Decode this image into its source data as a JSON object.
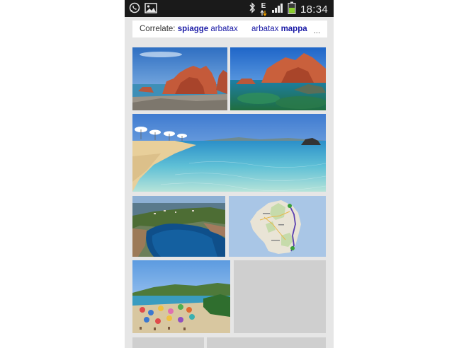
{
  "status_bar": {
    "time": "18:34",
    "network_letter": "E",
    "icons": [
      "whatsapp-icon",
      "gallery-icon",
      "bluetooth-icon",
      "data-arrows-icon",
      "signal-icon",
      "battery-icon"
    ]
  },
  "related_searches": {
    "label": "Correlate:",
    "items": [
      {
        "bold": "spiagge",
        "normal": "arbatax"
      },
      {
        "normal": "arbatax",
        "bold": "mappa"
      }
    ],
    "more_label": "..."
  },
  "images": [
    {
      "name": "red-rocks-arbatax-photo"
    },
    {
      "name": "red-rocks-clear-water-photo"
    },
    {
      "name": "beach-umbrellas-shore-photo"
    },
    {
      "name": "rocky-cove-aerial-photo"
    },
    {
      "name": "sardinia-route-map-image"
    },
    {
      "name": "crowded-beach-photo"
    },
    {
      "name": "loading-placeholder"
    },
    {
      "name": "loading-placeholder"
    },
    {
      "name": "loading-placeholder"
    }
  ],
  "colors": {
    "status_bar_bg": "#1a1a1a",
    "page_bg": "#e6e6e6",
    "link": "#1a1aa6",
    "placeholder": "#cfcfcf"
  }
}
